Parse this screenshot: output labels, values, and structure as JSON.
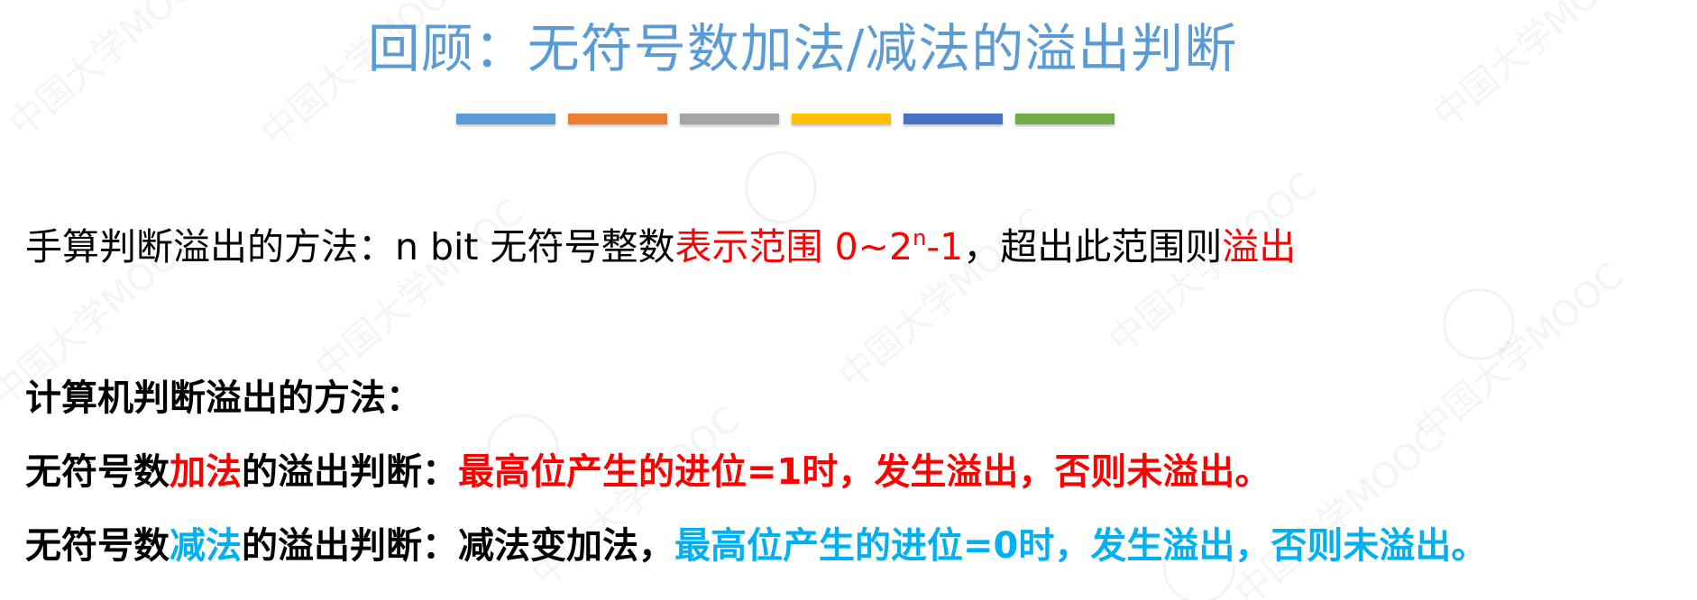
{
  "colors": {
    "title": "#5b9bd5",
    "highlight_red": "#ff0000",
    "highlight_blue": "#00b0f0",
    "text": "#000000"
  },
  "title": "回顾：无符号数加法/减法的溢出判断",
  "color_bars": [
    {
      "color": "#5b9bd5"
    },
    {
      "color": "#ed7d31"
    },
    {
      "color": "#a5a5a5"
    },
    {
      "color": "#ffc000"
    },
    {
      "color": "#4472c4"
    },
    {
      "color": "#70ad47"
    }
  ],
  "manual": {
    "prefix": "手算判断溢出的方法：n bit 无符号整数",
    "range_label": "表示范围 0~2",
    "exponent": "n",
    "range_tail": "-1",
    "middle": "，超出此范围则",
    "overflow": "溢出"
  },
  "computer": {
    "heading": "计算机判断溢出的方法：",
    "add": {
      "prefix": "无符号数",
      "op": "加法",
      "middle": "的溢出判断：",
      "rule": "最高位产生的进位=1时，发生溢出，否则未溢出。"
    },
    "sub": {
      "prefix": "无符号数",
      "op": "减法",
      "middle": "的溢出判断：减法变加法，",
      "rule": "最高位产生的进位=0时，发生溢出，否则未溢出。"
    }
  }
}
